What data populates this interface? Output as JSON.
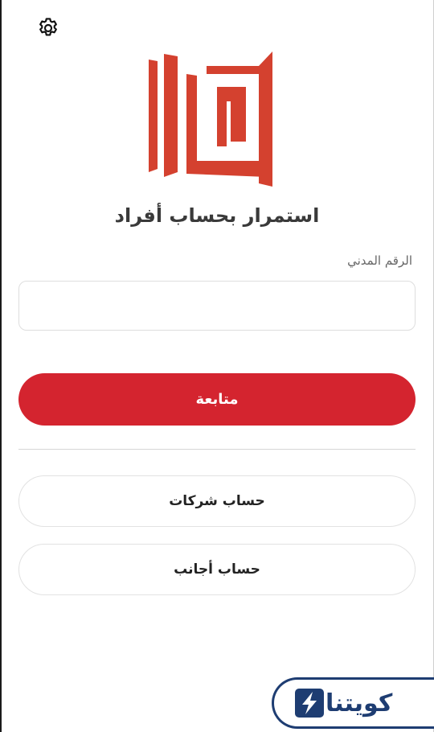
{
  "header": {
    "settings_icon": "gear-icon"
  },
  "logo": {
    "name": "brand-logo",
    "color": "#d4412f"
  },
  "page": {
    "title": "استمرار بحساب أفراد"
  },
  "form": {
    "civil_id_label": "الرقم المدني",
    "civil_id_value": "",
    "civil_id_placeholder": ""
  },
  "actions": {
    "continue_label": "متابعة",
    "companies_label": "حساب شركات",
    "foreigners_label": "حساب أجانب"
  },
  "watermark": {
    "text": "كويتنا",
    "icon": "bolt-badge-icon"
  },
  "colors": {
    "primary": "#d4242f",
    "brand_blue": "#1e3d72"
  }
}
